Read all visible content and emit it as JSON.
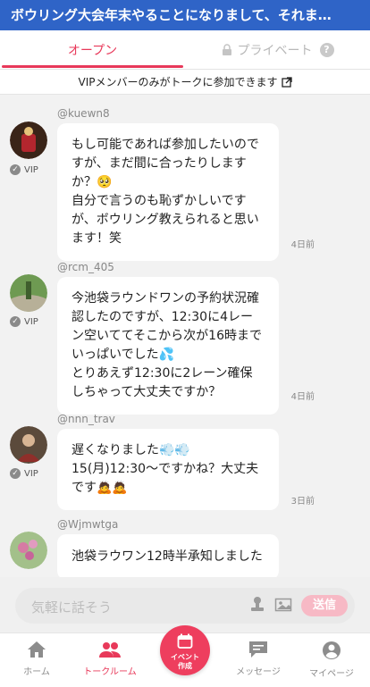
{
  "header": {
    "title": "ボウリング大会年末やることになりまして、それま…"
  },
  "tabs": {
    "open": "オープン",
    "private": "プライベート",
    "help": "?"
  },
  "notice": "VIPメンバーのみがトークに参加できます",
  "messages": [
    {
      "user": "@kuewn8",
      "badge": "VIP",
      "text": "もし可能であれば参加したいのですが、まだ間に合ったりしますか？🥺\n自分で言うのも恥ずかしいですが、ボウリング教えられると思います！笑",
      "time": "4日前"
    },
    {
      "user": "@rcm_405",
      "badge": "VIP",
      "text": "今池袋ラウンドワンの予約状況確認したのですが、12:30に4レーン空いててそこから次が16時までいっぱいでした💦\nとりあえず12:30に2レーン確保しちゃって大丈夫ですか？",
      "time": "4日前"
    },
    {
      "user": "@nnn_trav",
      "badge": "VIP",
      "text": "遅くなりました💨💨\n15(月)12:30〜ですかね？大丈夫です🙇🙇",
      "time": "3日前"
    },
    {
      "user": "@Wjmwtga",
      "badge": "",
      "text": "池袋ラウワン12時半承知しました",
      "time": ""
    }
  ],
  "input": {
    "placeholder": "気軽に話そう",
    "send": "送信"
  },
  "nav": {
    "home": "ホーム",
    "talk": "トークルーム",
    "event_line1": "イベント",
    "event_line2": "作成",
    "message": "メッセージ",
    "mypage": "マイページ"
  },
  "colors": {
    "accent": "#e8395a",
    "header": "#2f64c7"
  }
}
